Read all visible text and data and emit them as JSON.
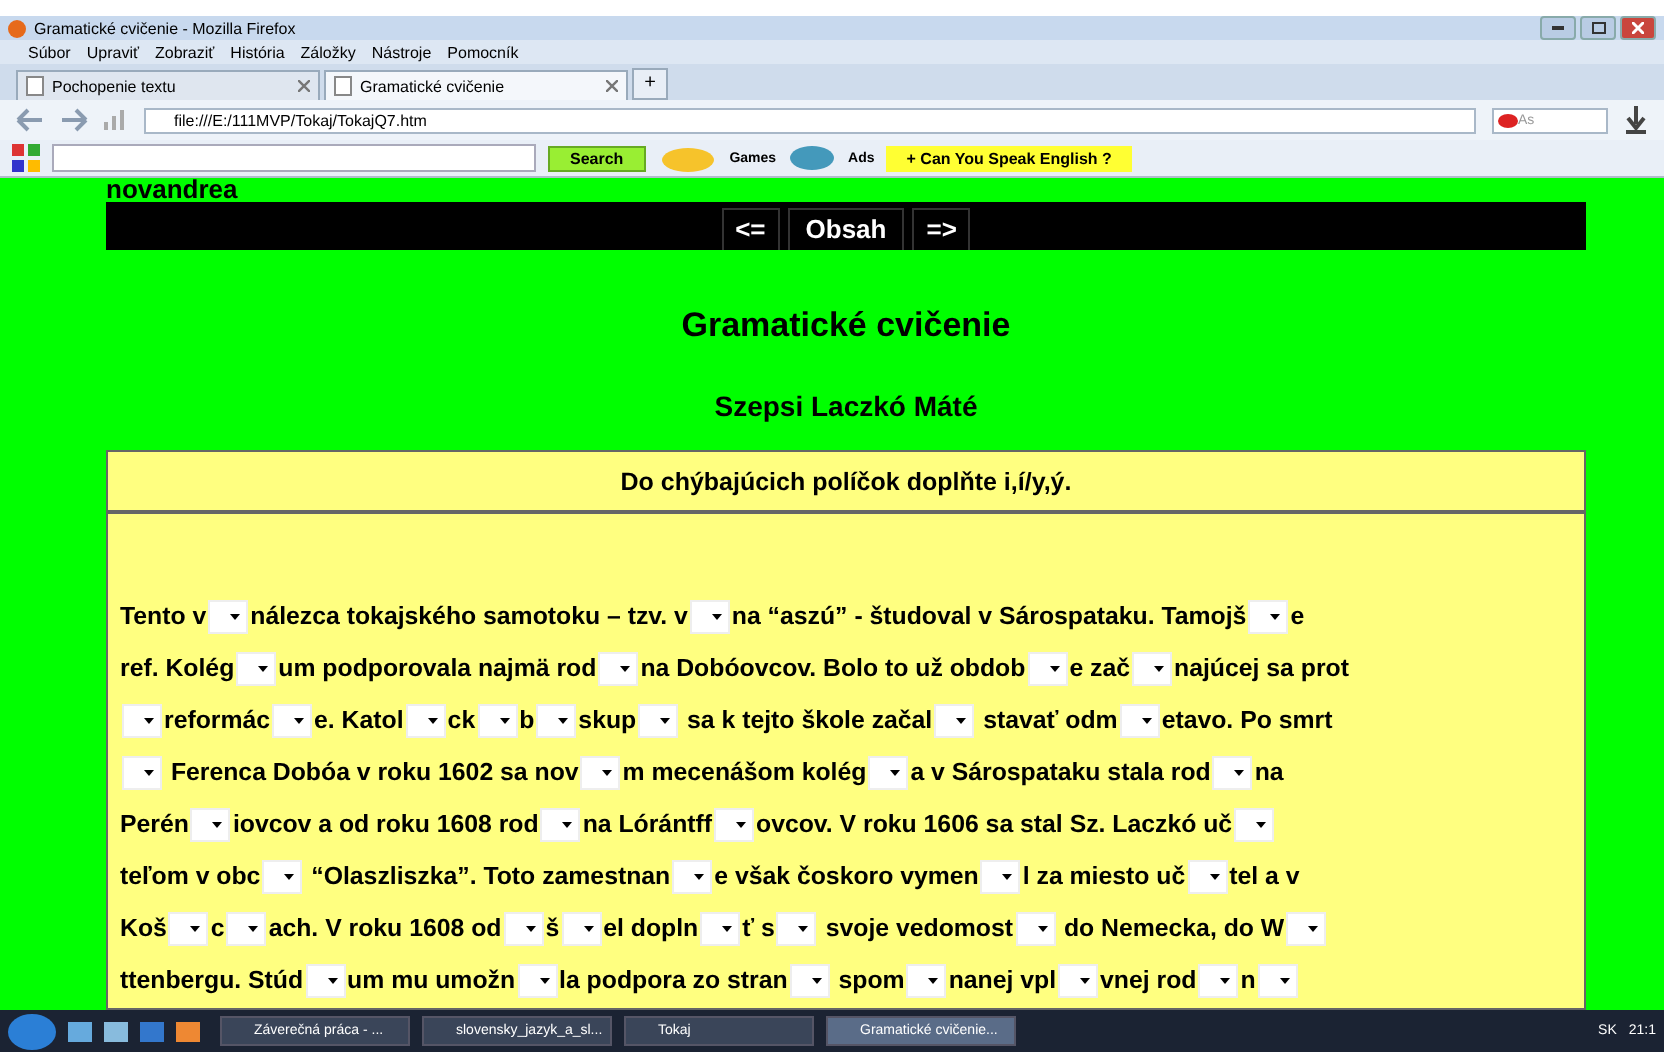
{
  "window": {
    "title": "Gramatické cvičenie - Mozilla Firefox"
  },
  "menu": [
    "Súbor",
    "Upraviť",
    "Zobraziť",
    "História",
    "Záložky",
    "Nástroje",
    "Pomocník"
  ],
  "tabs": [
    {
      "label": "Pochopenie textu",
      "selected": false
    },
    {
      "label": "Gramatické cvičenie",
      "selected": true
    }
  ],
  "new_tab": "+",
  "address": "file:///E:/111MVP/Tokaj/TokajQ7.htm",
  "search_box": "As",
  "toolbar": {
    "search": "Search",
    "games": "Games",
    "ads": "Ads",
    "promo": "+ Can You Speak English ?"
  },
  "page": {
    "site": "novandrea",
    "nav": [
      "<=",
      "Obsah",
      "=>"
    ],
    "title": "Gramatické cvičenie",
    "author": "Szepsi Laczkó Máté",
    "instruction": "Do chýbajúcich políčok doplňte i,í/y,ý.",
    "lines": [
      [
        {
          "kind": "text",
          "text": "Tento v"
        },
        {
          "kind": "blank"
        },
        {
          "kind": "text",
          "text": "nálezca tokajského samotoku – tzv. v"
        },
        {
          "kind": "blank"
        },
        {
          "kind": "text",
          "text": "na “aszú” - študoval v Sárospataku. Tamojš"
        },
        {
          "kind": "blank"
        },
        {
          "kind": "text",
          "text": "e"
        }
      ],
      [
        {
          "kind": "text",
          "text": "ref. Kolég"
        },
        {
          "kind": "blank"
        },
        {
          "kind": "text",
          "text": "um podporovala najmä rod"
        },
        {
          "kind": "blank"
        },
        {
          "kind": "text",
          "text": "na Dobóovcov. Bolo to už obdob"
        },
        {
          "kind": "blank"
        },
        {
          "kind": "text",
          "text": "e zač"
        },
        {
          "kind": "blank"
        },
        {
          "kind": "text",
          "text": "najúcej sa prot"
        }
      ],
      [
        {
          "kind": "blank"
        },
        {
          "kind": "text",
          "text": "reformác"
        },
        {
          "kind": "blank"
        },
        {
          "kind": "text",
          "text": "e. Katol"
        },
        {
          "kind": "blank"
        },
        {
          "kind": "text",
          "text": "ck"
        },
        {
          "kind": "blank"
        },
        {
          "kind": "text",
          "text": "b"
        },
        {
          "kind": "blank"
        },
        {
          "kind": "text",
          "text": "skup"
        },
        {
          "kind": "blank"
        },
        {
          "kind": "text",
          "text": " sa k tejto škole začal"
        },
        {
          "kind": "blank"
        },
        {
          "kind": "text",
          "text": " stavať odm"
        },
        {
          "kind": "blank"
        },
        {
          "kind": "text",
          "text": "etavo. Po smrt"
        }
      ],
      [
        {
          "kind": "blank"
        },
        {
          "kind": "text",
          "text": " Ferenca Dobóa v roku 1602 sa nov"
        },
        {
          "kind": "blank"
        },
        {
          "kind": "text",
          "text": "m mecenášom kolég"
        },
        {
          "kind": "blank"
        },
        {
          "kind": "text",
          "text": "a v Sárospataku stala rod"
        },
        {
          "kind": "blank"
        },
        {
          "kind": "text",
          "text": "na"
        }
      ],
      [
        {
          "kind": "text",
          "text": "Perén"
        },
        {
          "kind": "blank"
        },
        {
          "kind": "text",
          "text": "iovcov a od roku 1608 rod"
        },
        {
          "kind": "blank"
        },
        {
          "kind": "text",
          "text": "na Lórántff"
        },
        {
          "kind": "blank"
        },
        {
          "kind": "text",
          "text": "ovcov. V roku 1606 sa stal Sz. Laczkó uč"
        },
        {
          "kind": "blank"
        }
      ],
      [
        {
          "kind": "text",
          "text": "teľom v obc"
        },
        {
          "kind": "blank"
        },
        {
          "kind": "text",
          "text": " “Olaszliszka”. Toto zamestnan"
        },
        {
          "kind": "blank"
        },
        {
          "kind": "text",
          "text": "e však čoskoro vymen"
        },
        {
          "kind": "blank"
        },
        {
          "kind": "text",
          "text": "l za miesto uč"
        },
        {
          "kind": "blank"
        },
        {
          "kind": "text",
          "text": "tel a v"
        }
      ],
      [
        {
          "kind": "text",
          "text": "Koš"
        },
        {
          "kind": "blank"
        },
        {
          "kind": "text",
          "text": "c"
        },
        {
          "kind": "blank"
        },
        {
          "kind": "text",
          "text": "ach. V roku 1608 od"
        },
        {
          "kind": "blank"
        },
        {
          "kind": "text",
          "text": "š"
        },
        {
          "kind": "blank"
        },
        {
          "kind": "text",
          "text": "el dopln"
        },
        {
          "kind": "blank"
        },
        {
          "kind": "text",
          "text": "ť s"
        },
        {
          "kind": "blank"
        },
        {
          "kind": "text",
          "text": " svoje vedomost"
        },
        {
          "kind": "blank"
        },
        {
          "kind": "text",
          "text": " do Nemecka, do W"
        },
        {
          "kind": "blank"
        }
      ],
      [
        {
          "kind": "text",
          "text": "ttenbergu. Stúd"
        },
        {
          "kind": "blank"
        },
        {
          "kind": "text",
          "text": "um mu umožn"
        },
        {
          "kind": "blank"
        },
        {
          "kind": "text",
          "text": "la podpora zo stran"
        },
        {
          "kind": "blank"
        },
        {
          "kind": "text",
          "text": " spom"
        },
        {
          "kind": "blank"
        },
        {
          "kind": "text",
          "text": "nanej vpl"
        },
        {
          "kind": "blank"
        },
        {
          "kind": "text",
          "text": "vnej rod"
        },
        {
          "kind": "blank"
        },
        {
          "kind": "text",
          "text": "n"
        },
        {
          "kind": "blank"
        }
      ]
    ]
  },
  "taskbar": {
    "items": [
      {
        "label": "Záverečná práca - ...",
        "selected": false
      },
      {
        "label": "slovensky_jazyk_a_sl...",
        "selected": false
      },
      {
        "label": "Tokaj",
        "selected": false
      },
      {
        "label": "Gramatické cvičenie...",
        "selected": true
      }
    ],
    "language": "SK",
    "clock": "21:1"
  }
}
